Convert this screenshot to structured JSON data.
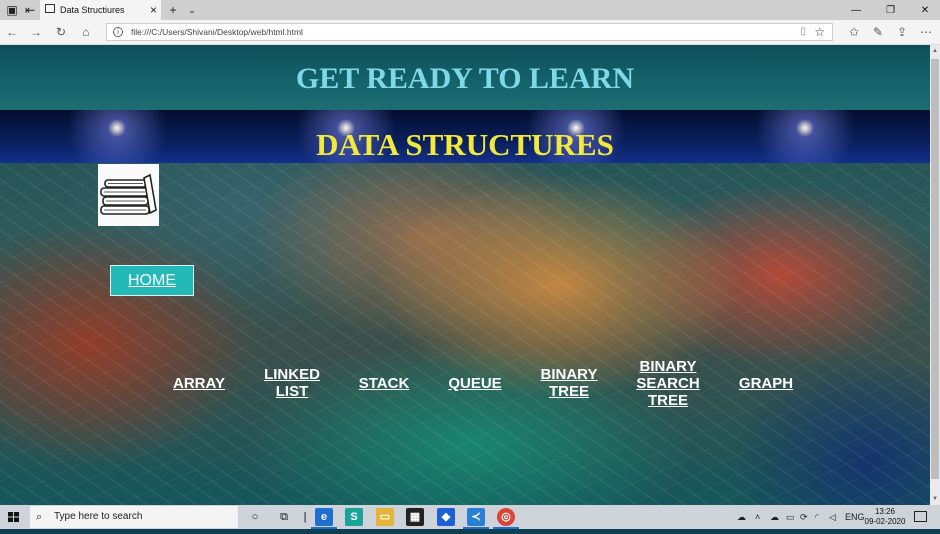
{
  "browser": {
    "tab_title": "Data Structiures",
    "address": "file:///C:/Users/Shivani/Desktop/web/html.html",
    "new_tab_symbol": "+",
    "close_symbol": "×"
  },
  "page": {
    "heading": "GET READY TO LEARN",
    "subheading": "DATA STRUCTURES",
    "home_label": "HOME",
    "topics": [
      {
        "line1": "ARRAY",
        "line2": "",
        "line3": ""
      },
      {
        "line1": "LINKED",
        "line2": "LIST",
        "line3": ""
      },
      {
        "line1": "STACK",
        "line2": "",
        "line3": ""
      },
      {
        "line1": "QUEUE",
        "line2": "",
        "line3": ""
      },
      {
        "line1": "BINARY",
        "line2": "TREE",
        "line3": ""
      },
      {
        "line1": "BINARY",
        "line2": "SEARCH",
        "line3": "TREE"
      },
      {
        "line1": "GRAPH",
        "line2": "",
        "line3": ""
      }
    ]
  },
  "taskbar": {
    "search_placeholder": "Type here to search",
    "language": "ENG",
    "time": "13:26",
    "date": "09-02-2020"
  },
  "colors": {
    "heading": "#7fd8e8",
    "subheading": "#f2e93a",
    "home_button": "#22b9b6"
  }
}
